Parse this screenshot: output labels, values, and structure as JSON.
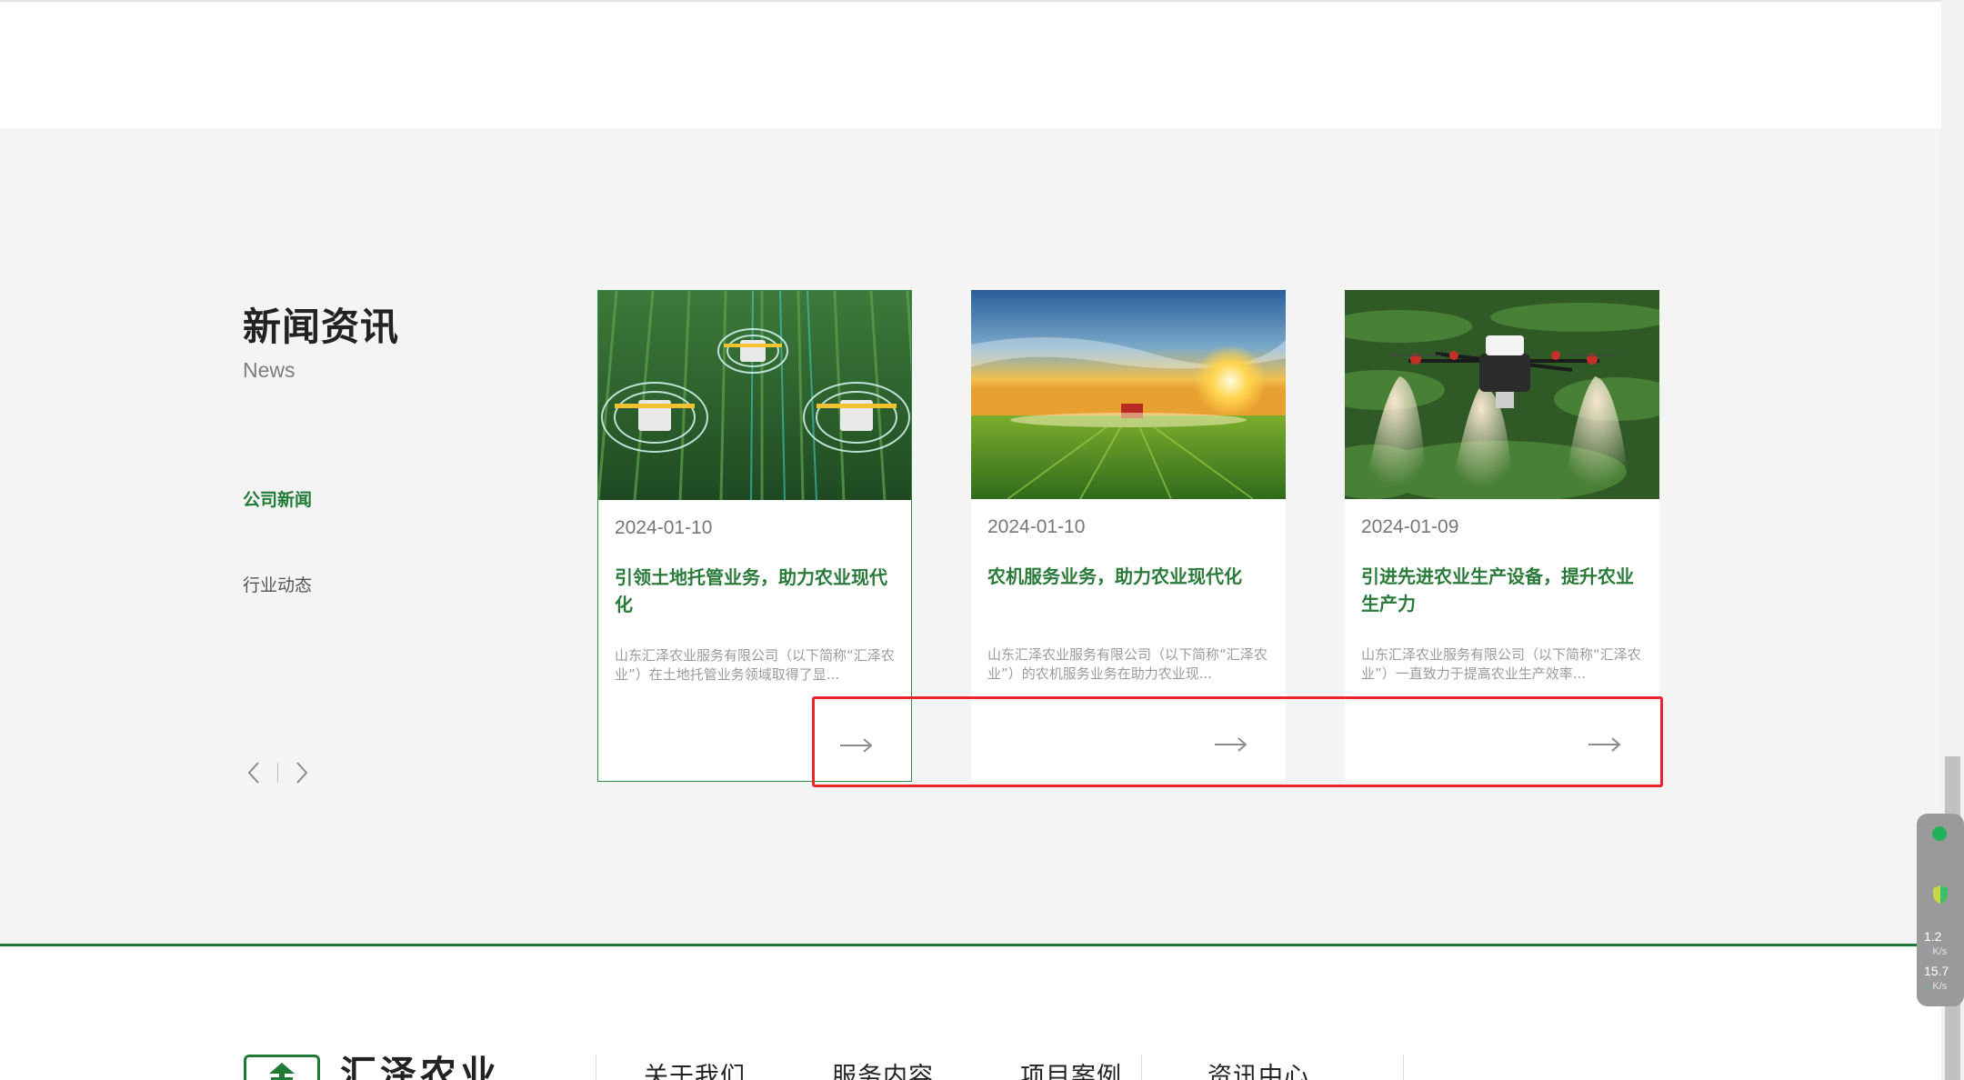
{
  "section": {
    "title": "新闻资讯",
    "subtitle": "News",
    "categories": [
      "公司新闻",
      "行业动态"
    ],
    "active_category": "公司新闻"
  },
  "cards": [
    {
      "date": "2024-01-10",
      "title": "引领土地托管业务，助力农业现代化",
      "desc": "山东汇泽农业服务有限公司（以下简称“汇泽农业”）在土地托管业务领域取得了显...",
      "image": "autonomous-tractors-field"
    },
    {
      "date": "2024-01-10",
      "title": "农机服务业务，助力农业现代化",
      "desc": "山东汇泽农业服务有限公司（以下简称“汇泽农业”）的农机服务业务在助力农业现...",
      "image": "sunset-tractor-spraying"
    },
    {
      "date": "2024-01-09",
      "title": "引进先进农业生产设备，提升农业生产力",
      "desc": "山东汇泽农业服务有限公司（以下简称“汇泽农业”）一直致力于提高农业生产效率...",
      "image": "spraying-drone"
    }
  ],
  "footer": {
    "logo_text": "汇泽农业",
    "nav": [
      "关于我们",
      "服务内容",
      "项目案例",
      "资讯中心"
    ]
  },
  "speed_widget": {
    "upload": "1.2",
    "download": "15.7",
    "unit": "K/s"
  },
  "colors": {
    "brand_green": "#1f7a35",
    "highlight_red": "#e8262b",
    "section_bg": "#f4f4f4"
  },
  "icons": [
    "arrow-left-icon",
    "arrow-right-icon",
    "more-arrow-icon",
    "logo-icon",
    "status-dot-icon",
    "shield-icon"
  ]
}
